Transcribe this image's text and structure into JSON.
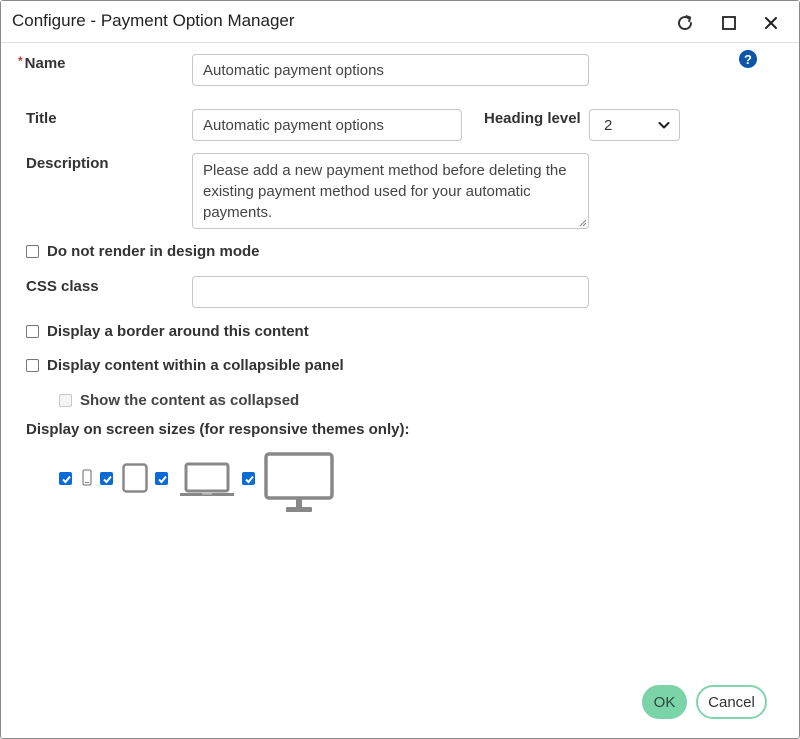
{
  "window": {
    "title": "Configure - Payment Option Manager"
  },
  "form": {
    "name_label": "Name",
    "name_required_mark": "*",
    "name_value": "Automatic payment options",
    "title_label": "Title",
    "title_value": "Automatic payment options",
    "heading_label": "Heading level",
    "heading_value": "2",
    "description_label": "Description",
    "description_value": "Please add a new payment method before deleting the existing payment method used for your automatic payments.",
    "no_render_label": "Do not render in design mode",
    "no_render_checked": false,
    "css_label": "CSS class",
    "css_value": "",
    "border_label": "Display a border around this content",
    "border_checked": false,
    "collapsible_label": "Display content within a collapsible panel",
    "collapsible_checked": false,
    "collapsed_label": "Show the content as collapsed",
    "collapsed_checked": false,
    "screen_sizes_label": "Display on screen sizes (for responsive themes only):",
    "devices": [
      {
        "name": "phone",
        "icon": "phone-icon",
        "checked": true
      },
      {
        "name": "tablet",
        "icon": "tablet-icon",
        "checked": true
      },
      {
        "name": "laptop",
        "icon": "laptop-icon",
        "checked": true
      },
      {
        "name": "desktop",
        "icon": "desktop-icon",
        "checked": true
      }
    ]
  },
  "buttons": {
    "ok": "OK",
    "cancel": "Cancel"
  },
  "help": {
    "glyph": "?"
  },
  "colors": {
    "accent": "#7bd3a8",
    "checkbox": "#0b6bd6",
    "help": "#0d55a8"
  }
}
